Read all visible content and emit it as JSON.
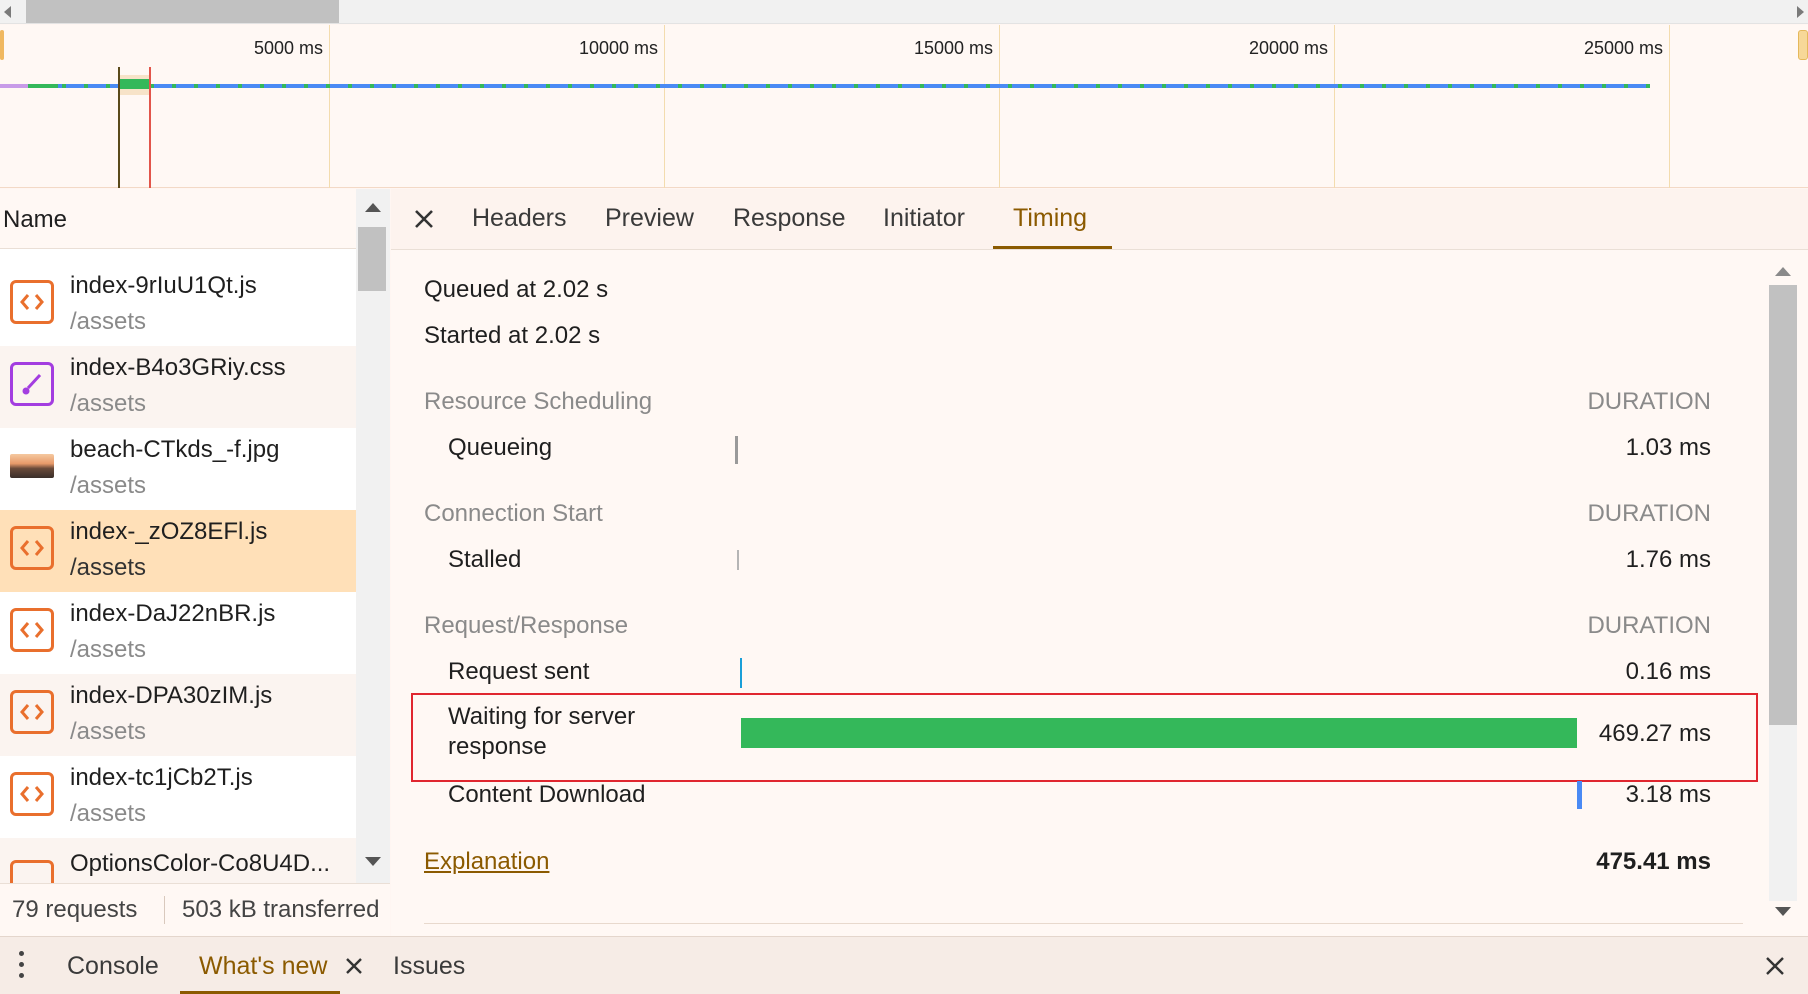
{
  "overview": {
    "ticks": [
      "5000 ms",
      "10000 ms",
      "15000 ms",
      "20000 ms",
      "25000 ms"
    ]
  },
  "name_panel": {
    "header": "Name",
    "rows": [
      {
        "name": "index-9rIuU1Qt.js",
        "path": "/assets",
        "type": "script-icon"
      },
      {
        "name": "index-B4o3GRiy.css",
        "path": "/assets",
        "type": "stylesheet-icon"
      },
      {
        "name": "beach-CTkds_-f.jpg",
        "path": "/assets",
        "type": "image-thumbnail"
      },
      {
        "name": "index-_zOZ8EFl.js",
        "path": "/assets",
        "type": "script-icon",
        "selected": true
      },
      {
        "name": "index-DaJ22nBR.js",
        "path": "/assets",
        "type": "script-icon"
      },
      {
        "name": "index-DPA30zIM.js",
        "path": "/assets",
        "type": "script-icon"
      },
      {
        "name": "index-tc1jCb2T.js",
        "path": "/assets",
        "type": "script-icon"
      },
      {
        "name": "OptionsColor-Co8U4D...",
        "path": "",
        "type": "script-icon"
      }
    ],
    "status": {
      "requests": "79 requests",
      "transferred": "503 kB transferred"
    }
  },
  "detail": {
    "tabs": [
      "Headers",
      "Preview",
      "Response",
      "Initiator",
      "Timing"
    ],
    "active_tab": "Timing",
    "queued": "Queued at 2.02 s",
    "started": "Started at 2.02 s",
    "sections": [
      {
        "title": "Resource Scheduling",
        "duration_label": "DURATION",
        "items": [
          {
            "label": "Queueing",
            "value": "1.03 ms"
          }
        ]
      },
      {
        "title": "Connection Start",
        "duration_label": "DURATION",
        "items": [
          {
            "label": "Stalled",
            "value": "1.76 ms"
          }
        ]
      },
      {
        "title": "Request/Response",
        "duration_label": "DURATION",
        "items": [
          {
            "label": "Request sent",
            "value": "0.16 ms"
          },
          {
            "label": "Waiting for server response",
            "value": "469.27 ms"
          },
          {
            "label": "Content Download",
            "value": "3.18 ms"
          }
        ]
      }
    ],
    "explanation": "Explanation",
    "total": "475.41 ms"
  },
  "drawer": {
    "tabs": [
      "Console",
      "What's new",
      "Issues"
    ],
    "active_tab": "What's new"
  },
  "colors": {
    "accent": "#8b5a00",
    "waiting_bar": "#34b85a",
    "download_bar": "#4a8af4",
    "request_bar": "#1a9fd8",
    "highlight": "#e0262f",
    "selected_row": "#ffe0b8"
  }
}
